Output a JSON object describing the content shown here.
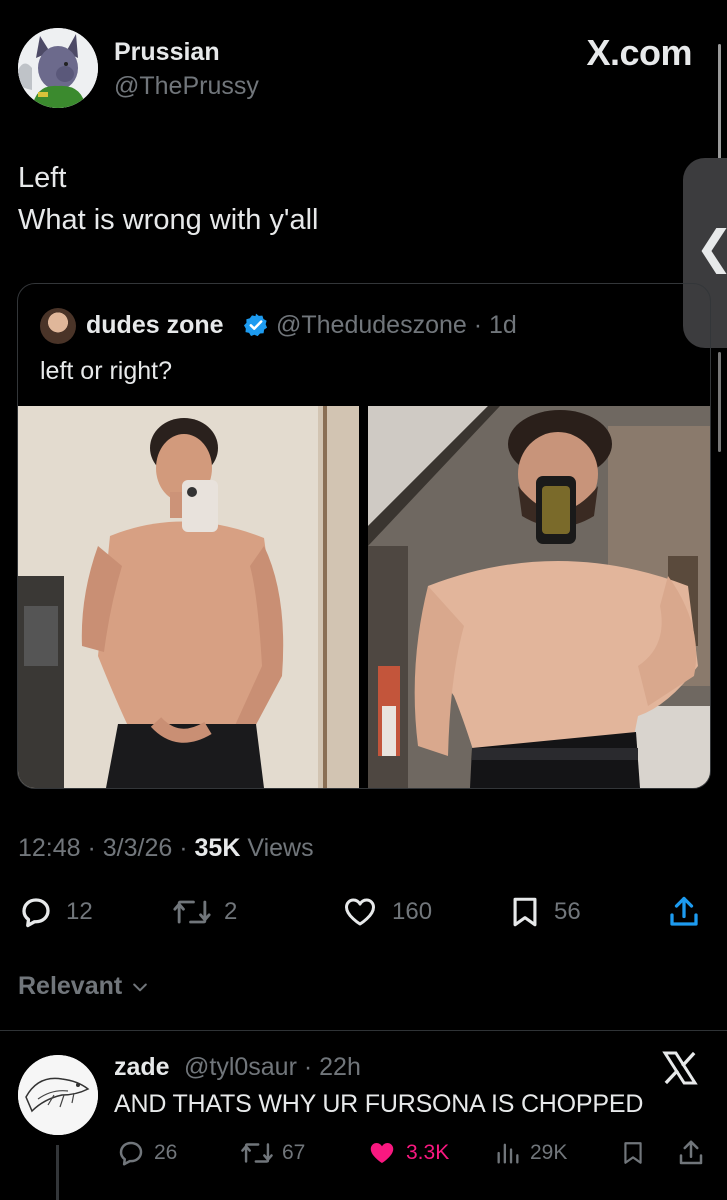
{
  "author": {
    "name": "Prussian",
    "handle": "@ThePrussy"
  },
  "site_label": "X.com",
  "side_tab_glyph": "❮",
  "tweet": {
    "lines": [
      "Left",
      "What is wrong with y'all"
    ]
  },
  "quote": {
    "name": "dudes zone",
    "handle": "@Thedudeszone",
    "age": "1d",
    "text": "left or right?"
  },
  "meta": {
    "time": "12:48",
    "date": "3/3/26",
    "views_count": "35K",
    "views_label": "Views"
  },
  "actions": {
    "replies": "12",
    "reposts": "2",
    "likes": "160",
    "bookmarks": "56"
  },
  "sort": {
    "label": "Relevant"
  },
  "reply": {
    "name": "zade",
    "handle": "@tyl0saur",
    "age": "22h",
    "text": "AND THATS WHY UR FURSONA IS CHOPPED",
    "stats": {
      "replies": "26",
      "reposts": "67",
      "likes": "3.3K",
      "views": "29K"
    }
  },
  "colors": {
    "background": "#000000",
    "text": "#e7e9ea",
    "muted": "#71767b",
    "verified": "#1d9bf0",
    "liked": "#f91880",
    "divider": "#2f3336"
  },
  "icons": [
    "reply-icon",
    "repost-icon",
    "like-icon",
    "bookmark-icon",
    "share-icon",
    "views-icon",
    "verified-badge-icon",
    "chevron-down-icon",
    "x-logo-icon"
  ]
}
